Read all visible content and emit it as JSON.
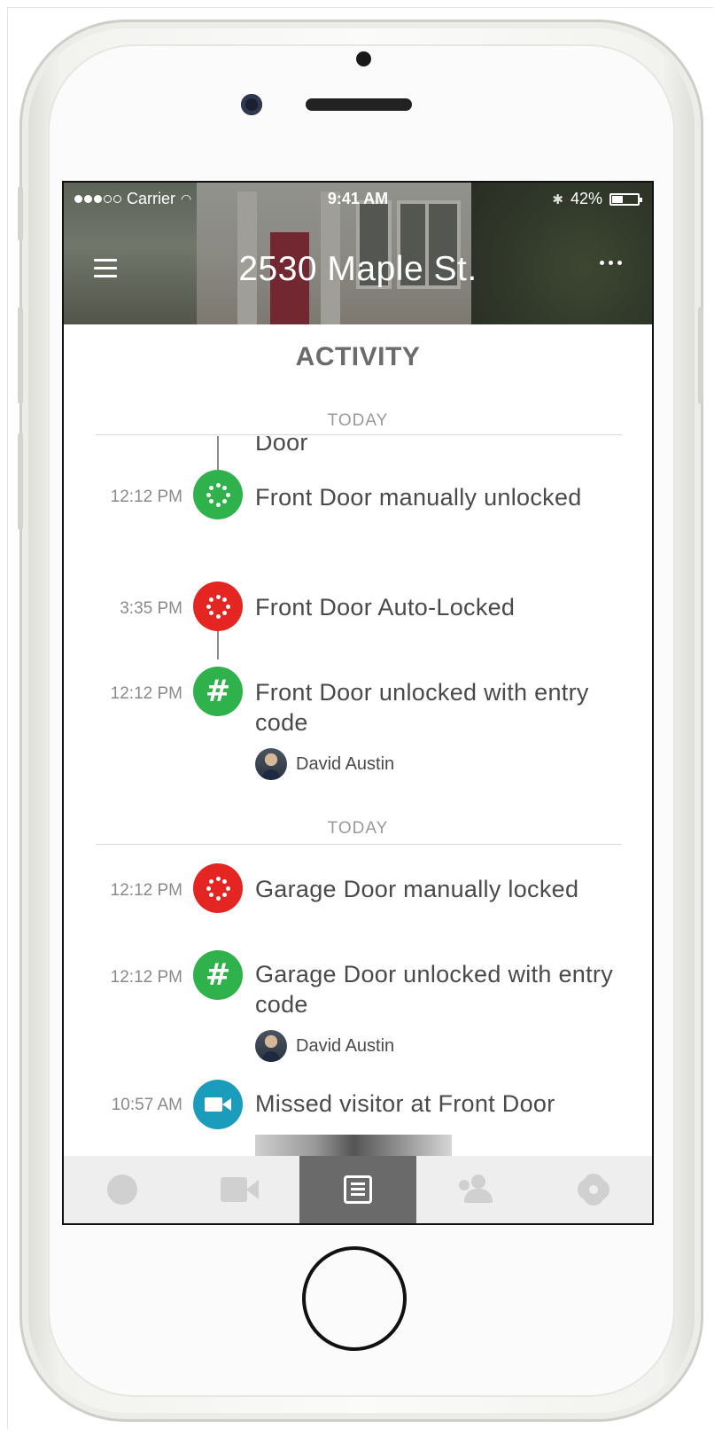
{
  "status_bar": {
    "carrier": "Carrier",
    "time": "9:41 AM",
    "battery_text": "42%",
    "battery_level": 0.42,
    "signal_bars_filled": 3,
    "signal_bars_total": 5
  },
  "header": {
    "title": "2530 Maple St.",
    "menu_icon": "hamburger-menu-icon",
    "more_icon": "ellipsis-icon"
  },
  "activity": {
    "title": "ACTIVITY",
    "groups": [
      {
        "day_label": "TODAY",
        "events": [
          {
            "partial_text": "Door"
          },
          {
            "time": "12:12 PM",
            "icon": "unlock-ring-icon",
            "color": "#2fb14b",
            "text": "Front Door manually unlocked"
          },
          {
            "time": "3:35 PM",
            "icon": "lock-ring-icon",
            "color": "#e52521",
            "text": "Front Door Auto-Locked"
          },
          {
            "time": "12:12 PM",
            "icon": "entry-code-hash-icon",
            "color": "#2fb14b",
            "text": "Front Door unlocked with entry code",
            "user": "David Austin"
          }
        ]
      },
      {
        "day_label": "TODAY",
        "events": [
          {
            "time": "12:12 PM",
            "icon": "lock-ring-icon",
            "color": "#e52521",
            "text": "Garage Door manually locked"
          },
          {
            "time": "12:12 PM",
            "icon": "entry-code-hash-icon",
            "color": "#2fb14b",
            "text": "Garage Door unlocked with entry code",
            "user": "David Austin"
          },
          {
            "time": "10:57 AM",
            "icon": "video-camera-icon",
            "color": "#1c9cbc",
            "text": "Missed visitor at Front Door"
          }
        ]
      }
    ]
  },
  "tabbar": {
    "tabs": [
      {
        "name": "home",
        "icon": "circle-icon",
        "active": false
      },
      {
        "name": "video",
        "icon": "video-camera-icon",
        "active": false
      },
      {
        "name": "activity",
        "icon": "list-icon",
        "active": true
      },
      {
        "name": "users",
        "icon": "users-icon",
        "active": false
      },
      {
        "name": "settings",
        "icon": "gear-icon",
        "active": false
      }
    ]
  },
  "colors": {
    "lock_red": "#e52521",
    "unlock_green": "#2fb14b",
    "video_teal": "#1c9cbc",
    "active_tab": "#6a6a6a"
  }
}
